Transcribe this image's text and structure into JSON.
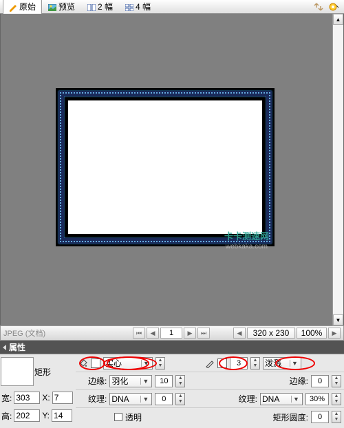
{
  "tabs": {
    "original": "原始",
    "preview": "预览",
    "two_up": "2 幅",
    "four_up": "4 幅"
  },
  "watermark": {
    "cn": "卡卡测速网",
    "en": "webkaka.com"
  },
  "status": {
    "format_label": "JPEG (文档)",
    "page": "1",
    "dimensions": "320 x 230",
    "zoom": "100%"
  },
  "properties": {
    "title": "属性"
  },
  "shape": {
    "label": "矩形",
    "fill_mode": "实心",
    "edge_label": "边缘:",
    "edge_mode": "羽化",
    "edge_amount": "10",
    "texture_label": "纹理:",
    "texture_value": "DNA",
    "texture_amount": "0",
    "transparent_label": "透明"
  },
  "stroke": {
    "width": "3",
    "mode": "泼溅",
    "edge_label": "边缘:",
    "edge_amount": "0",
    "texture_label": "纹理:",
    "texture_value": "DNA",
    "texture_amount": "30%",
    "round_label": "矩形圆度:",
    "round_value": "0"
  },
  "dims": {
    "w_label": "宽:",
    "w": "303",
    "h_label": "高:",
    "h": "202",
    "x_label": "X:",
    "x": "7",
    "y_label": "Y:",
    "y": "14"
  }
}
